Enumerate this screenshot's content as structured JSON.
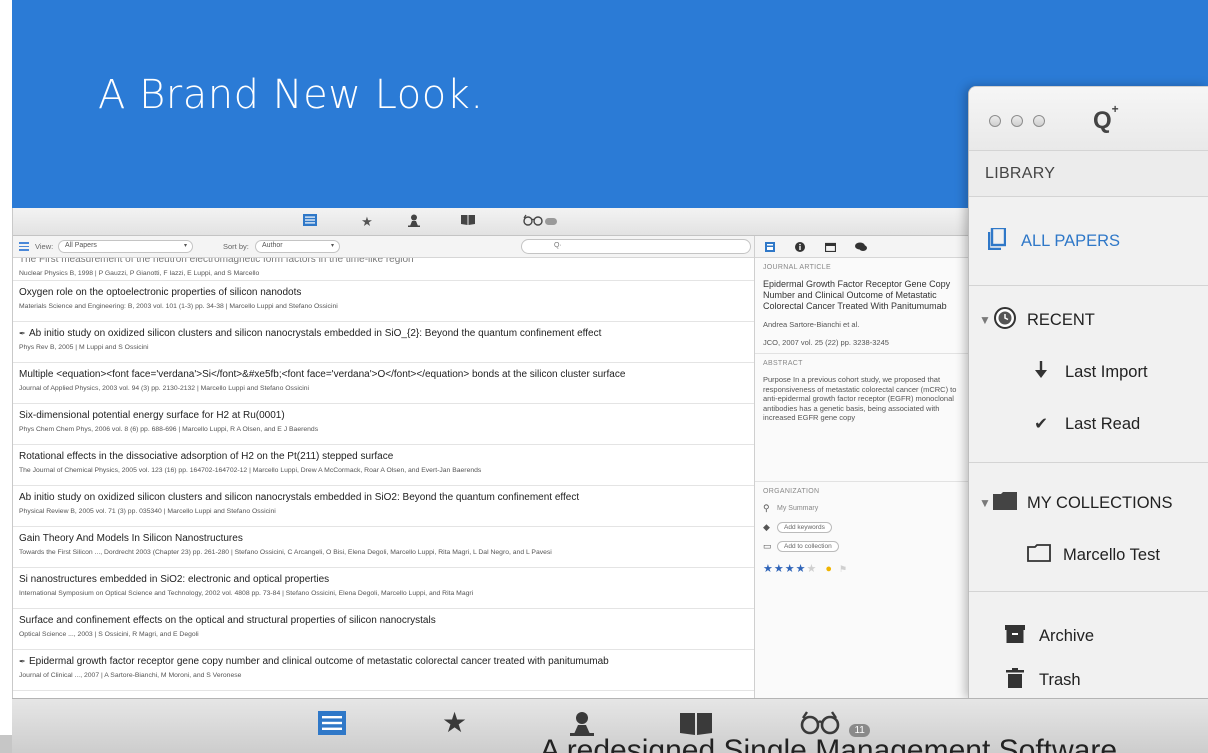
{
  "hero": {
    "title": "A Brand New Look."
  },
  "main_toolbar": {
    "items": [
      "list-icon",
      "star-icon",
      "person-icon",
      "book-icon",
      "glasses-icon"
    ],
    "badge": ""
  },
  "filter_bar": {
    "view_label": "View:",
    "view_value": "All Papers",
    "sort_label": "Sort by:",
    "sort_value": "Author",
    "search_placeholder": "Q·"
  },
  "papers": [
    {
      "title": "The First measurement of the neutron electromagnetic form factors in the time-like region",
      "meta": "Nuclear Physics B, 1998 | P Gauzzi, P Gianotti, F Iazzi, E Luppi, and S Marcello",
      "pinned": false
    },
    {
      "title": "Oxygen role on the optoelectronic properties of silicon nanodots",
      "meta": "Materials Science and Engineering: B, 2003 vol. 101 (1-3) pp. 34-38 | Marcello Luppi and Stefano Ossicini",
      "pinned": false
    },
    {
      "title": "Ab initio study on oxidized silicon clusters and silicon nanocrystals embedded in SiO_{2}: Beyond the quantum confinement effect",
      "meta": "Phys Rev B, 2005 | M Luppi and S Ossicini",
      "pinned": true
    },
    {
      "title": "Multiple <equation><font face='verdana'>Si</font>&#xe5fb;<font face='verdana'>O</font></equation> bonds at the silicon cluster surface",
      "meta": "Journal of Applied Physics, 2003 vol. 94 (3) pp. 2130-2132 | Marcello Luppi and Stefano Ossicini",
      "pinned": false
    },
    {
      "title": "Six-dimensional potential energy surface for H2 at Ru(0001)",
      "meta": "Phys Chem Chem Phys, 2006 vol. 8 (6) pp. 688-696 | Marcello Luppi, R A Olsen, and E J Baerends",
      "pinned": false
    },
    {
      "title": "Rotational effects in the dissociative adsorption of H2 on the Pt(211) stepped surface",
      "meta": "The Journal of Chemical Physics, 2005 vol. 123 (16) pp. 164702-164702-12 | Marcello Luppi, Drew A McCormack, Roar A Olsen, and Evert-Jan Baerends",
      "pinned": false
    },
    {
      "title": "Ab initio study on oxidized silicon clusters and silicon nanocrystals embedded in SiO2: Beyond the quantum confinement effect",
      "meta": "Physical Review B, 2005 vol. 71 (3) pp. 035340 | Marcello Luppi and Stefano Ossicini",
      "pinned": false
    },
    {
      "title": "Gain Theory And Models In Silicon Nanostructures",
      "meta": "Towards the First Silicon ..., Dordrecht 2003 (Chapter 23) pp. 261-280 | Stefano Ossicini, C Arcangeli, O Bisi, Elena Degoli, Marcello Luppi, Rita Magri, L Dal Negro, and L Pavesi",
      "pinned": false
    },
    {
      "title": "Si nanostructures embedded in SiO2: electronic and optical properties",
      "meta": "International Symposium on Optical Science and Technology, 2002 vol. 4808 pp. 73-84 | Stefano Ossicini, Elena Degoli, Marcello Luppi, and Rita Magri",
      "pinned": false
    },
    {
      "title": "Surface and confinement effects on the optical and structural properties of silicon nanocrystals",
      "meta": "Optical Science ..., 2003 | S Ossicini, R Magri, and E Degoli",
      "pinned": false
    },
    {
      "title": "Epidermal growth factor receptor gene copy number and clinical outcome of metastatic colorectal cancer treated with panitumumab",
      "meta": "Journal of Clinical ..., 2007 | A Sartore-Bianchi, M Moroni, and S Veronese",
      "pinned": true
    }
  ],
  "detail": {
    "type_label": "JOURNAL ARTICLE",
    "title": "Epidermal Growth Factor Receptor Gene Copy Number and Clinical Outcome of Metastatic Colorectal Cancer Treated With Panitumumab",
    "authors": "Andrea Sartore-Bianchi et al.",
    "citation": "JCO, 2007 vol. 25 (22) pp. 3238-3245",
    "abstract_label": "ABSTRACT",
    "abstract": "Purpose In a previous cohort study, we proposed that responsiveness of metastatic colorectal cancer (mCRC) to anti-epidermal growth factor receptor (EGFR) monoclonal antibodies has a genetic basis, being associated with increased EGFR gene copy",
    "organization_label": "ORGANIZATION",
    "summary": "My Summary",
    "add_keywords": "Add keywords",
    "add_collection": "Add to collection",
    "rating": 4,
    "rating_max": 5
  },
  "library": {
    "header": "LIBRARY",
    "all_papers": "ALL PAPERS",
    "recent": "RECENT",
    "last_import": "Last Import",
    "last_read": "Last Read",
    "my_collections": "MY COLLECTIONS",
    "collection": "Marcello Test",
    "archive": "Archive",
    "trash": "Trash"
  },
  "bottom_toolbar": {
    "badge": "11"
  },
  "partial_caption": "A redesigned Single Management Software",
  "colors": {
    "hero": "#2b7bd6",
    "accent": "#2f78c8",
    "star": "#2f64b8"
  }
}
